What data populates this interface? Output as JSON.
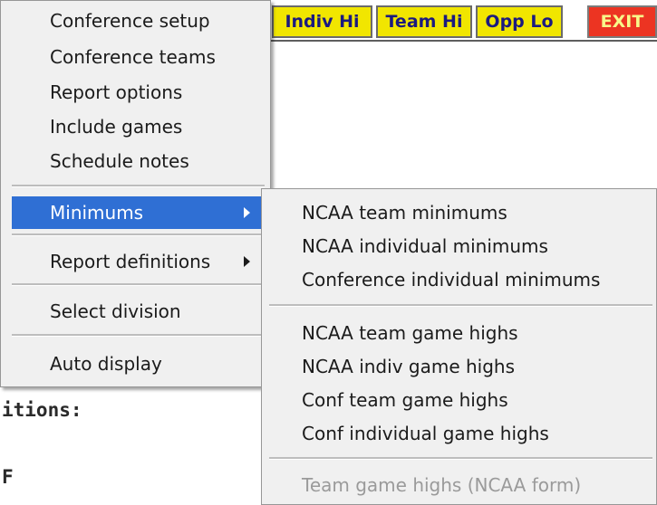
{
  "toolbar": {
    "buttons": [
      {
        "label": "Indiv Hi"
      },
      {
        "label": "Team Hi"
      },
      {
        "label": "Opp Lo"
      },
      {
        "label": "EXIT"
      }
    ]
  },
  "console": {
    "line1": "itions:",
    "line2": "F"
  },
  "main_menu": {
    "items": [
      {
        "label": "Conference setup"
      },
      {
        "label": "Conference teams"
      },
      {
        "label": "Report options"
      },
      {
        "label": "Include games"
      },
      {
        "label": "Schedule notes"
      },
      {
        "label": "Minimums",
        "selected": true,
        "submenu": true
      },
      {
        "label": "Report definitions",
        "submenu": true
      },
      {
        "label": "Select division"
      },
      {
        "label": "Auto display"
      }
    ]
  },
  "submenu": {
    "items": [
      {
        "label": "NCAA team minimums"
      },
      {
        "label": "NCAA individual minimums"
      },
      {
        "label": "Conference individual minimums"
      },
      {
        "label": "NCAA team game highs"
      },
      {
        "label": "NCAA indiv game highs"
      },
      {
        "label": "Conf team game highs"
      },
      {
        "label": "Conf individual game highs"
      },
      {
        "label": "Team game highs (NCAA form)",
        "disabled": true
      }
    ]
  },
  "colors": {
    "selection": "#2f6fd4",
    "toolbar_button": "#f1e600",
    "exit_button": "#ec3422"
  }
}
